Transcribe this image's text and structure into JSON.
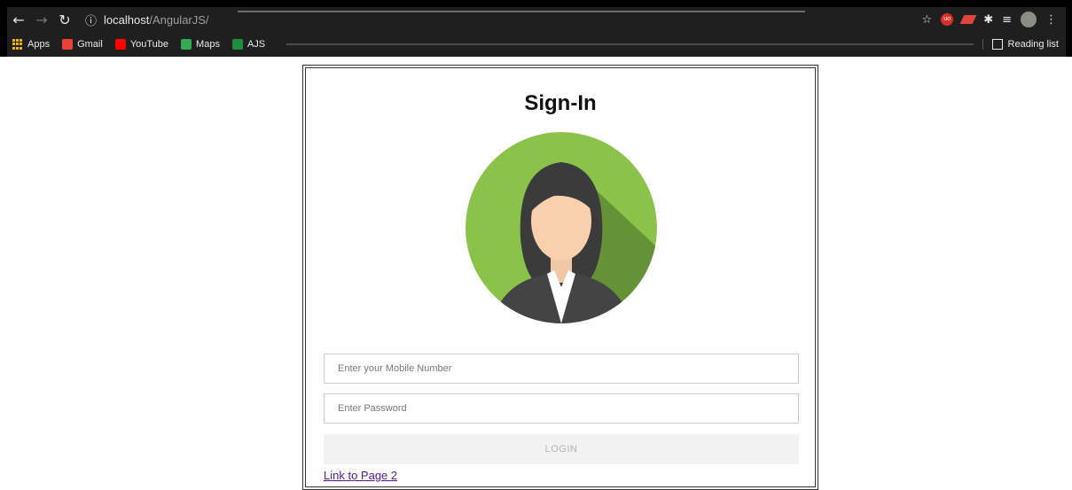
{
  "browser": {
    "url_host": "localhost",
    "url_path": "/AngularJS/",
    "bookmarks": [
      {
        "label": "Apps",
        "icon": "apps-grid-icon"
      },
      {
        "label": "Gmail",
        "icon": "gmail-icon"
      },
      {
        "label": "YouTube",
        "icon": "youtube-icon"
      },
      {
        "label": "Maps",
        "icon": "maps-icon"
      },
      {
        "label": "AJS",
        "icon": "ajs-icon"
      }
    ],
    "reading_list": "Reading list"
  },
  "signin": {
    "title": "Sign-In",
    "mobile_placeholder": "Enter your Mobile Number",
    "password_placeholder": "Enter Password",
    "login_label": "LOGIN",
    "link_label": "Link to Page 2"
  },
  "colors": {
    "avatar_bg": "#8bc34a",
    "login_bg": "#f2f2f2",
    "link": "#551a8b"
  }
}
